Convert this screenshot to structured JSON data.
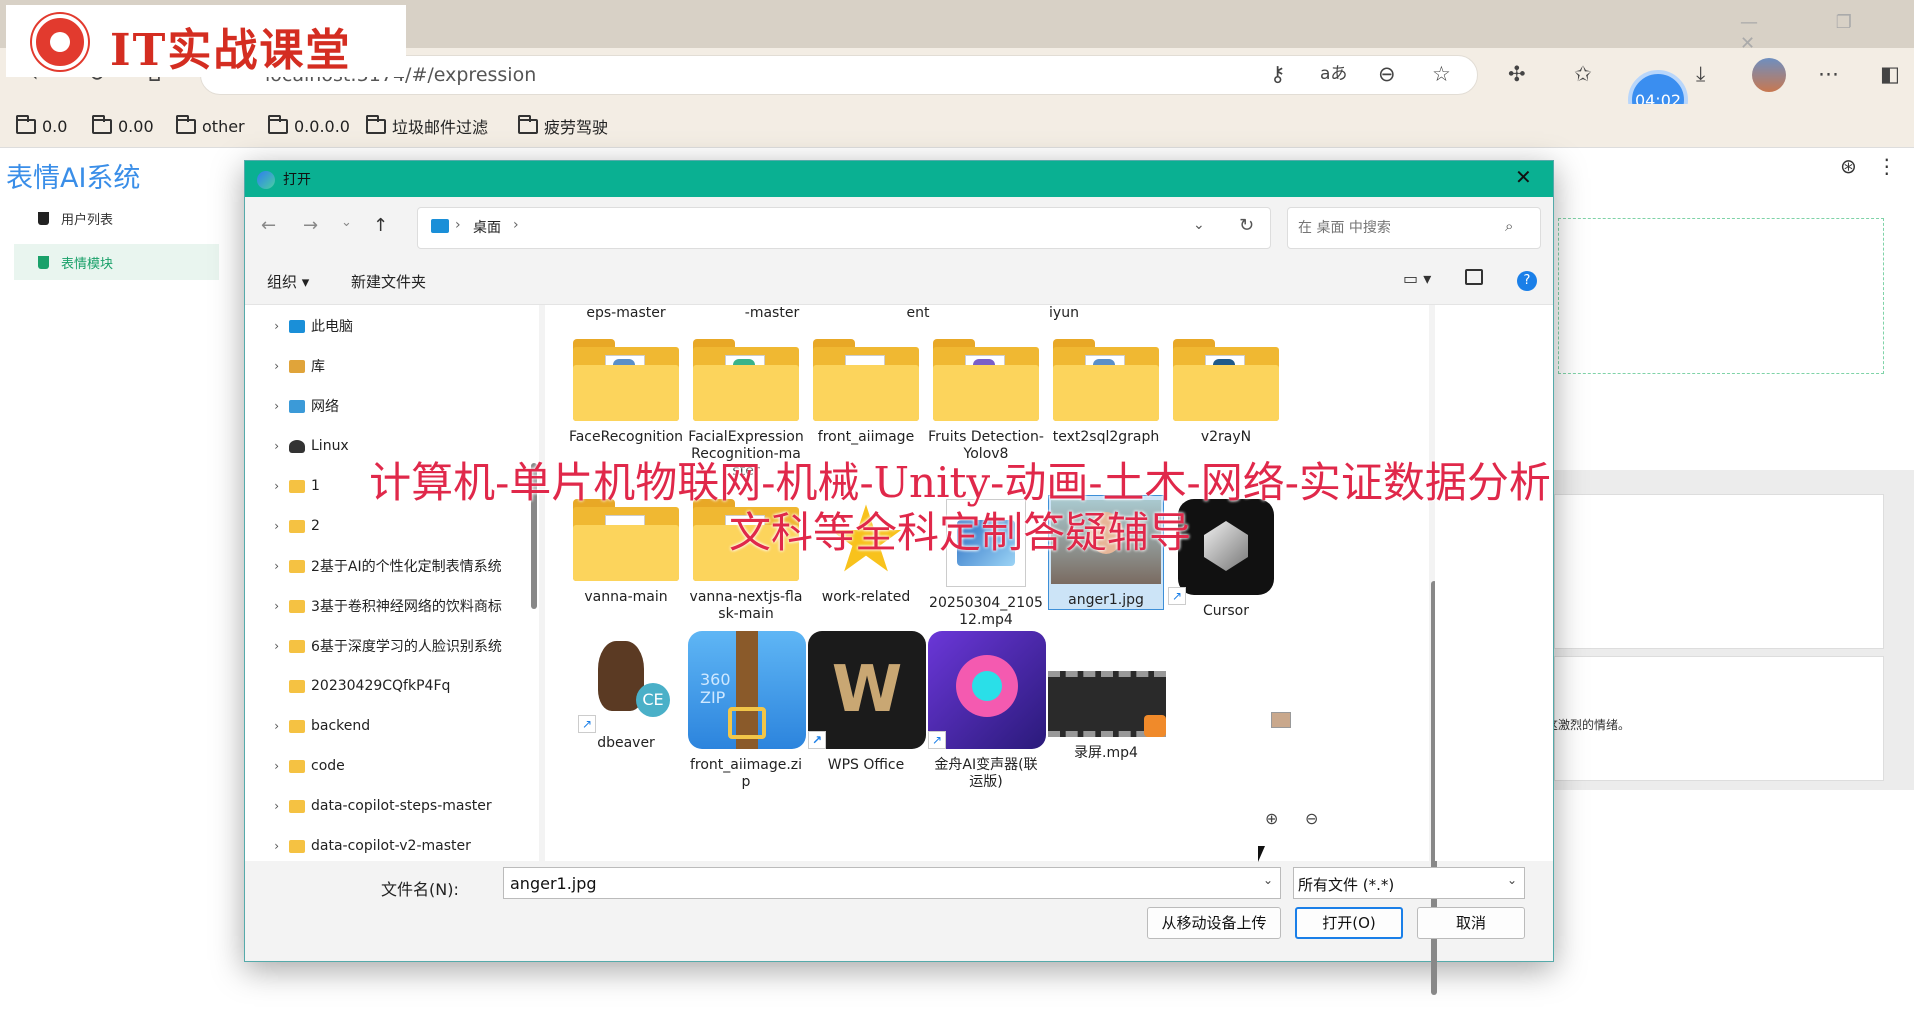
{
  "browser": {
    "address": "localhost:5174/#/expression",
    "timer": "04:02",
    "bookmarks": [
      "0.0",
      "0.00",
      "other",
      "0.0.0.0",
      "垃圾邮件过滤",
      "疲劳驾驶"
    ]
  },
  "overlay": {
    "logo_text": "IT实战课堂",
    "watermark_line1": "计算机-单片机物联网-机械-Unity-动画-土木-网络-实证数据分析",
    "watermark_line2": "文科等全科定制答疑辅导"
  },
  "app": {
    "title": "表情AI系统",
    "menu": [
      {
        "label": "用户列表",
        "active": false
      },
      {
        "label": "表情模块",
        "active": true
      }
    ],
    "card_text": "这激烈的情绪。"
  },
  "dialog": {
    "title": "打开",
    "path_label": "桌面",
    "search_placeholder": "在 桌面 中搜索",
    "organize_label": "组织",
    "new_folder_label": "新建文件夹",
    "help_label": "?",
    "nav_tree": [
      {
        "label": "此电脑",
        "arrow": "›",
        "kind": "pc"
      },
      {
        "label": "库",
        "arrow": "›",
        "kind": "lib"
      },
      {
        "label": "网络",
        "arrow": "›",
        "kind": "net"
      },
      {
        "label": "Linux",
        "arrow": "›",
        "kind": "lx"
      },
      {
        "label": "1",
        "arrow": "›",
        "kind": "folder"
      },
      {
        "label": "2",
        "arrow": "›",
        "kind": "folder"
      },
      {
        "label": "2基于AI的个性化定制表情系统",
        "arrow": "›",
        "kind": "folder"
      },
      {
        "label": "3基于卷积神经网络的饮料商标",
        "arrow": "›",
        "kind": "folder"
      },
      {
        "label": "6基于深度学习的人脸识别系统",
        "arrow": "›",
        "kind": "folder"
      },
      {
        "label": "20230429CQfkP4Fq",
        "arrow": "",
        "kind": "folder"
      },
      {
        "label": "backend",
        "arrow": "›",
        "kind": "folder"
      },
      {
        "label": "code",
        "arrow": "›",
        "kind": "folder"
      },
      {
        "label": "data-copilot-steps-master",
        "arrow": "›",
        "kind": "folder"
      },
      {
        "label": "data-copilot-v2-master",
        "arrow": "›",
        "kind": "folder"
      }
    ],
    "top_partial": [
      "eps-master",
      "-master",
      "ent",
      "iyun"
    ],
    "files": [
      {
        "label": "FaceRecognition",
        "kind": "folder",
        "badge": "#5a8fc8"
      },
      {
        "label": "FacialExpressionRecognition-master",
        "kind": "folder",
        "badge": "#3ab38a"
      },
      {
        "label": "front_aiimage",
        "kind": "folder",
        "badge": ""
      },
      {
        "label": "Fruits Detection-Yolov8",
        "kind": "folder",
        "badge": "#7a5fc8"
      },
      {
        "label": "text2sql2graph",
        "kind": "folder",
        "badge": "#5a8fc8"
      },
      {
        "label": "v2rayN",
        "kind": "folder",
        "badge": "#1f5a8a"
      },
      {
        "label": "vanna-main",
        "kind": "folder",
        "badge": ""
      },
      {
        "label": "vanna-nextjs-flask-main",
        "kind": "folder",
        "badge": ""
      },
      {
        "label": "work-related",
        "kind": "star",
        "badge": ""
      },
      {
        "label": "20250304_210512.mp4",
        "kind": "video",
        "badge": ""
      },
      {
        "label": "anger1.jpg",
        "kind": "photo",
        "badge": ""
      },
      {
        "label": "Cursor",
        "kind": "cursor",
        "badge": ""
      },
      {
        "label": "dbeaver",
        "kind": "dbeaver",
        "badge": ""
      },
      {
        "label": "front_aiimage.zip",
        "kind": "zip",
        "badge": ""
      },
      {
        "label": "WPS Office",
        "kind": "wps",
        "badge": ""
      },
      {
        "label": "金舟AI变声器(联运版)",
        "kind": "voice",
        "badge": ""
      },
      {
        "label": "录屏.mp4",
        "kind": "screenrec",
        "badge": ""
      }
    ],
    "filename_label": "文件名(N):",
    "filename_value": "anger1.jpg",
    "filetype_value": "所有文件 (*.*)",
    "upload_label": "从移动设备上传",
    "open_label": "打开(O)",
    "cancel_label": "取消"
  },
  "colors": {
    "dialog_title_bar": "#0ab092",
    "accent_blue": "#1a7fe8",
    "app_title": "#3a8ee8",
    "active_menu": "#1aa16a",
    "watermark": "#e0284a",
    "logo": "#d42d21"
  },
  "icons": {
    "back": "arrow-left-icon",
    "forward": "arrow-right-icon",
    "up": "arrow-up-icon",
    "refresh": "refresh-icon",
    "search": "search-icon",
    "close": "close-icon",
    "view": "view-icon",
    "pane": "preview-pane-icon",
    "zoom_in": "zoom-in-icon",
    "zoom_out": "zoom-out-icon"
  }
}
